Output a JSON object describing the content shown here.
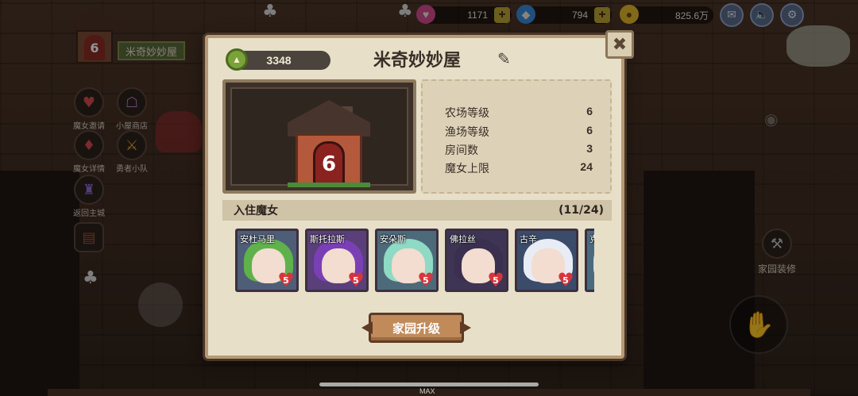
{
  "resources": [
    {
      "icon": "heart-gem-icon",
      "value": "1171",
      "color": "#d24a8c"
    },
    {
      "icon": "diamond-icon",
      "value": "794",
      "color": "#3a88d8"
    },
    {
      "icon": "gold-coin-icon",
      "value": "825.6万",
      "color": "#e0b52a"
    }
  ],
  "top_buttons": [
    "mail-icon",
    "speaker-icon",
    "settings-icon"
  ],
  "home": {
    "level": "6",
    "name": "米奇妙妙屋"
  },
  "side_menu": [
    {
      "label": "魔女邀请",
      "icon": "heart-invite-icon"
    },
    {
      "label": "小屋商店",
      "icon": "shop-icon"
    },
    {
      "label": "魔女详情",
      "icon": "witch-detail-icon"
    },
    {
      "label": "勇者小队",
      "icon": "hero-team-icon"
    },
    {
      "label": "返回主城",
      "icon": "castle-icon"
    }
  ],
  "decorate": {
    "label": "家园装修"
  },
  "dialog": {
    "title": "米奇妙妙屋",
    "currency": "3348",
    "house_level": "6",
    "stats": [
      {
        "label": "农场等级",
        "value": "6"
      },
      {
        "label": "渔场等级",
        "value": "6"
      },
      {
        "label": "房间数",
        "value": "3"
      },
      {
        "label": "魔女上限",
        "value": "24"
      }
    ],
    "residents_title": "入住魔女",
    "residents_count": "(11/24)",
    "residents": [
      {
        "name": "安杜马里",
        "level": "5",
        "bg": "#4f5e77",
        "hair": "#5fb24b"
      },
      {
        "name": "斯托拉斯",
        "level": "5",
        "bg": "#5a3f7a",
        "hair": "#7a3fb4"
      },
      {
        "name": "安朵斯",
        "level": "5",
        "bg": "#4d6a7a",
        "hair": "#8fdac4"
      },
      {
        "name": "佛拉丝",
        "level": "5",
        "bg": "#3e3554",
        "hair": "#3a2f4e"
      },
      {
        "name": "古辛",
        "level": "5",
        "bg": "#3b4b6a",
        "hair": "#e8ecf4"
      },
      {
        "name": "克",
        "level": "",
        "bg": "#4a6a80",
        "hair": "#bfe0e8"
      }
    ],
    "upgrade_label": "家园升级"
  },
  "footer": {
    "max_label": "MAX"
  }
}
